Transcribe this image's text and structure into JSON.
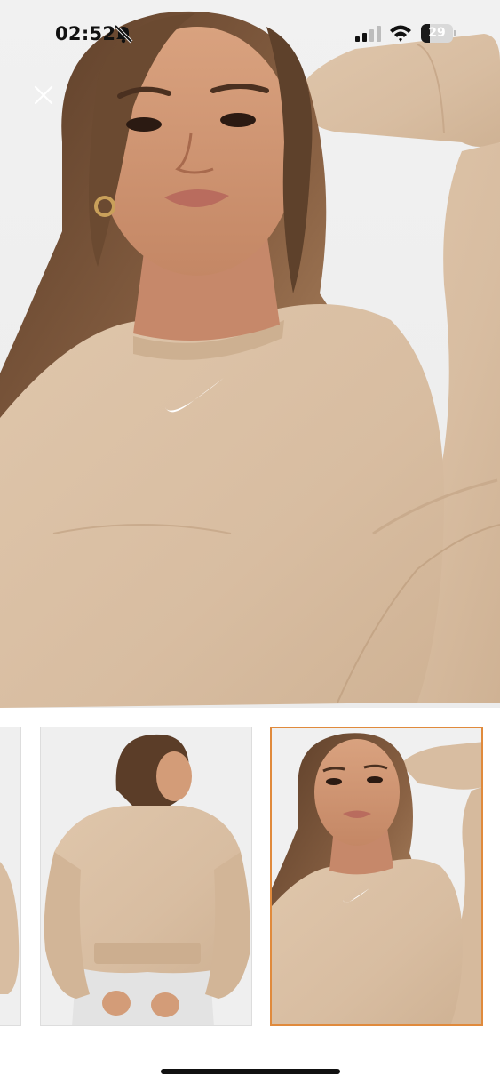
{
  "status_bar": {
    "time": "02:52",
    "battery_level": 29,
    "battery_label": "29",
    "signal_bars_active": 2,
    "signal_bars_total": 4,
    "icons": [
      "bell-slash-icon",
      "signal-icon",
      "wifi-icon",
      "battery-icon"
    ]
  },
  "viewer": {
    "close_icon": "close-icon",
    "main_image": "model-in-beige-sweatshirt-front",
    "thumbnails": [
      {
        "name": "side-view",
        "selected": false
      },
      {
        "name": "back-view",
        "selected": false
      },
      {
        "name": "front-view",
        "selected": true
      }
    ],
    "selected_index": 2
  },
  "colors": {
    "sweatshirt": "#d8bda1",
    "selected_border": "#e08a3c",
    "background": "#ffffff"
  }
}
